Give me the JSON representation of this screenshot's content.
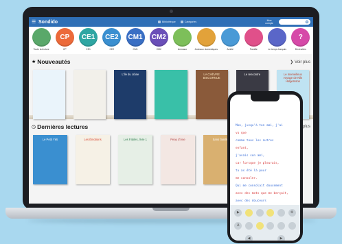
{
  "app": {
    "brand": "Sondido"
  },
  "topbar": {
    "link1": "Bibliothèque",
    "link2": "Catégories",
    "user": "Mon compte"
  },
  "categories": [
    {
      "short": "",
      "label": "Toute la lecture",
      "color": "#5aa86a"
    },
    {
      "short": "CP",
      "label": "CP",
      "color": "#ec6a3a"
    },
    {
      "short": "CE1",
      "label": "CE1",
      "color": "#2fa6a3"
    },
    {
      "short": "CE2",
      "label": "CE2",
      "color": "#3a8fd0"
    },
    {
      "short": "CM1",
      "label": "CM1",
      "color": "#3a6fc4"
    },
    {
      "short": "CM2",
      "label": "CM2",
      "color": "#6a4fb8"
    },
    {
      "short": "",
      "label": "Animaux",
      "color": "#7dbf5a"
    },
    {
      "short": "",
      "label": "Animaux domestiques",
      "color": "#e2a23a"
    },
    {
      "short": "",
      "label": "Amitié",
      "color": "#4a9ad6"
    },
    {
      "short": "",
      "label": "Famille",
      "color": "#e0508a"
    },
    {
      "short": "",
      "label": "Le temps français",
      "color": "#5a66c8"
    },
    {
      "short": "?",
      "label": "Devinettes",
      "color": "#d64aa8"
    }
  ],
  "sections": {
    "new_title": "Nouveautés",
    "new_more": "Voir plus",
    "recent_title": "Dernières lectures",
    "recent_more": "plus"
  },
  "new_books": [
    {
      "title": "",
      "bg": "#eaf4fb",
      "fg": "#2a5a8a"
    },
    {
      "title": "",
      "bg": "#f2f0ea",
      "fg": "#333"
    },
    {
      "title": "L'île du crâne",
      "bg": "#1e3c6a",
      "fg": "#ffffff"
    },
    {
      "title": "",
      "bg": "#39c0a8",
      "fg": "#fff"
    },
    {
      "title": "LA CHÈVRE BISCORNUE",
      "bg": "#8a5a3a",
      "fg": "#ffe9c2"
    },
    {
      "title": "Le rencontre",
      "bg": "#3a3a44",
      "fg": "#ffffff"
    },
    {
      "title": "Le merveilleux voyage de Nils Holgersson",
      "bg": "#bfe3f2",
      "fg": "#c0402a"
    }
  ],
  "recent_books": [
    {
      "title": "Le Petit Yéti",
      "bg": "#3a8fd0",
      "fg": "#ffffff"
    },
    {
      "title": "Les Émotions",
      "bg": "#f6f1e6",
      "fg": "#d8402a"
    },
    {
      "title": "Les Fables, livre 1",
      "bg": "#e6efe6",
      "fg": "#2a7a4a"
    },
    {
      "title": "Peau d'Âne",
      "bg": "#f3e7e3",
      "fg": "#b04040"
    },
    {
      "title": "Sans famille",
      "bg": "#d9b070",
      "fg": "#ffffff"
    }
  ],
  "phone": {
    "lines": [
      {
        "text": "Mon, jusqu'à ton ami, j'ai",
        "color": "#3a6fd8"
      },
      {
        "text": "vu que",
        "color": "#d83a3a"
      },
      {
        "text": "comme tous les autres",
        "color": "#3a6fd8"
      },
      {
        "text": "enfant,",
        "color": "#d83a3a"
      },
      {
        "text": "j'avais son ami,",
        "color": "#3a6fd8"
      },
      {
        "text": "car lorsque je pleurais,",
        "color": "#d83a3a"
      },
      {
        "text": "tu as été là pour",
        "color": "#3a6fd8"
      },
      {
        "text": "me consoler.",
        "color": "#d83a3a"
      },
      {
        "text": "Qui me consolait doucement",
        "color": "#3a6fd8"
      },
      {
        "text": "avec des mots que me berçait,",
        "color": "#d83a3a"
      },
      {
        "text": "avec des douceurs",
        "color": "#3a6fd8"
      },
      {
        "text": "en couleur.",
        "color": "#d83a3a"
      },
      {
        "text": "Pour cela et par bien d'autres",
        "color": "#3a6fd8"
      }
    ]
  }
}
